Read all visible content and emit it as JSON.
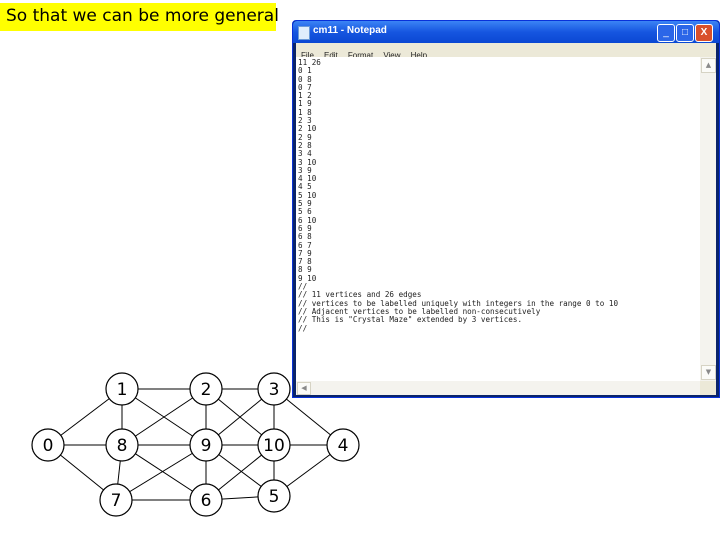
{
  "slide": {
    "title": "So that we can be more general"
  },
  "notepad": {
    "window_title": "cm11 - Notepad",
    "menu": [
      "File",
      "Edit",
      "Format",
      "View",
      "Help"
    ],
    "buttons": {
      "minimize": "_",
      "maximize": "□",
      "close": "X"
    },
    "content_lines": [
      "11 26",
      "0 1",
      "0 8",
      "0 7",
      "1 2",
      "1 9",
      "1 8",
      "2 3",
      "2 10",
      "2 9",
      "2 8",
      "3 4",
      "3 10",
      "3 9",
      "4 10",
      "4 5",
      "5 10",
      "5 9",
      "5 6",
      "6 10",
      "6 9",
      "6 8",
      "6 7",
      "7 9",
      "7 8",
      "8 9",
      "9 10",
      "//",
      "// 11 vertices and 26 edges",
      "// vertices to be labelled uniquely with integers in the range 0 to 10",
      "// Adjacent vertices to be labelled non-consecutively",
      "// This is \"Crystal Maze\" extended by 3 vertices.",
      "//"
    ]
  },
  "graph": {
    "nodes": [
      {
        "id": "0",
        "label": "0",
        "row": 1,
        "col": 0
      },
      {
        "id": "1",
        "label": "1",
        "row": 0,
        "col": 1
      },
      {
        "id": "2",
        "label": "2",
        "row": 0,
        "col": 2
      },
      {
        "id": "3",
        "label": "3",
        "row": 0,
        "col": 3
      },
      {
        "id": "4",
        "label": "4",
        "row": 1,
        "col": 4
      },
      {
        "id": "5",
        "label": "5",
        "row": 2,
        "col": 3
      },
      {
        "id": "6",
        "label": "6",
        "row": 2,
        "col": 2
      },
      {
        "id": "7",
        "label": "7",
        "row": 2,
        "col": 1
      },
      {
        "id": "8",
        "label": "8",
        "row": 1,
        "col": 1
      },
      {
        "id": "9",
        "label": "9",
        "row": 1,
        "col": 2
      },
      {
        "id": "10",
        "label": "10",
        "row": 1,
        "col": 3
      }
    ],
    "edges": [
      [
        "0",
        "1"
      ],
      [
        "0",
        "8"
      ],
      [
        "0",
        "7"
      ],
      [
        "1",
        "2"
      ],
      [
        "1",
        "9"
      ],
      [
        "1",
        "8"
      ],
      [
        "2",
        "3"
      ],
      [
        "2",
        "10"
      ],
      [
        "2",
        "9"
      ],
      [
        "2",
        "8"
      ],
      [
        "3",
        "4"
      ],
      [
        "3",
        "10"
      ],
      [
        "3",
        "9"
      ],
      [
        "4",
        "10"
      ],
      [
        "4",
        "5"
      ],
      [
        "5",
        "10"
      ],
      [
        "5",
        "9"
      ],
      [
        "5",
        "6"
      ],
      [
        "6",
        "10"
      ],
      [
        "6",
        "9"
      ],
      [
        "6",
        "8"
      ],
      [
        "6",
        "7"
      ],
      [
        "7",
        "9"
      ],
      [
        "7",
        "8"
      ],
      [
        "8",
        "9"
      ],
      [
        "9",
        "10"
      ]
    ]
  }
}
